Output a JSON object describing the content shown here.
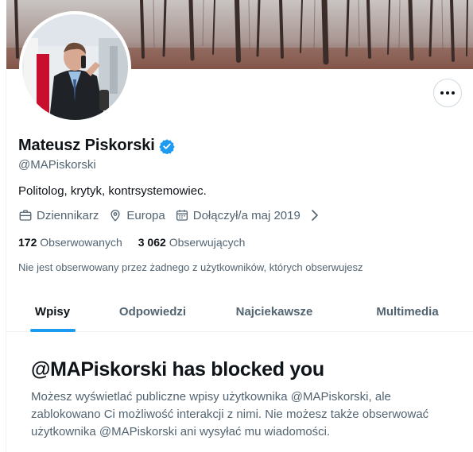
{
  "profile": {
    "name": "Mateusz Piskorski",
    "handle": "@MAPiskorski",
    "bio": "Politolog, krytyk, kontrsystemowiec.",
    "verified": true,
    "accent_color": "#1d9bf0"
  },
  "meta": {
    "profession": "Dziennikarz",
    "location": "Europa",
    "joined": "Dołączył/a maj 2019",
    "icons": [
      "briefcase-icon",
      "location-pin-icon",
      "calendar-icon",
      "chevron-right-icon"
    ]
  },
  "stats": {
    "following_count": "172",
    "following_label": "Obserwowanych",
    "followers_count": "3 062",
    "followers_label": "Obserwujących"
  },
  "followed_by_text": "Nie jest obserwowany przez żadnego z użytkowników, których obserwujesz",
  "tabs": [
    {
      "label": "Wpisy",
      "active": true
    },
    {
      "label": "Odpowiedzi",
      "active": false
    },
    {
      "label": "Najciekawsze",
      "active": false
    },
    {
      "label": "Multimedia",
      "active": false
    }
  ],
  "blocked": {
    "title": "@MAPiskorski has blocked you",
    "message": "Możesz wyświetlać publiczne wpisy użytkownika @MAPiskorski, ale zablokowano Ci możliwość interakcji z nimi. Nie możesz także obserwować użytkownika @MAPiskorski ani wysyłać mu wiadomości."
  }
}
